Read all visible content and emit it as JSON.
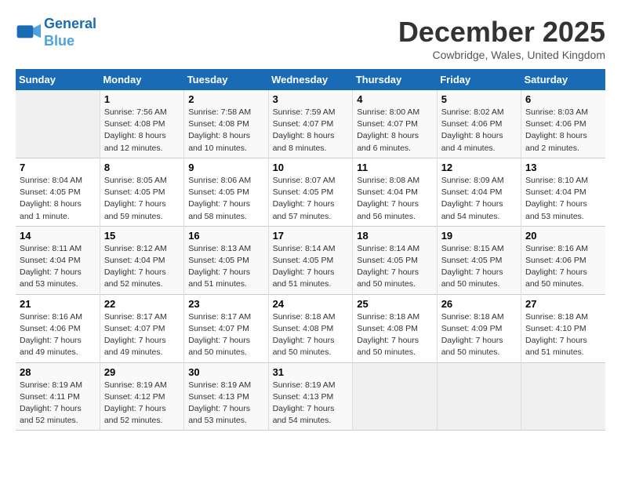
{
  "header": {
    "logo_line1": "General",
    "logo_line2": "Blue",
    "month_title": "December 2025",
    "location": "Cowbridge, Wales, United Kingdom"
  },
  "days_of_week": [
    "Sunday",
    "Monday",
    "Tuesday",
    "Wednesday",
    "Thursday",
    "Friday",
    "Saturday"
  ],
  "weeks": [
    [
      {
        "day": "",
        "info": ""
      },
      {
        "day": "1",
        "info": "Sunrise: 7:56 AM\nSunset: 4:08 PM\nDaylight: 8 hours\nand 12 minutes."
      },
      {
        "day": "2",
        "info": "Sunrise: 7:58 AM\nSunset: 4:08 PM\nDaylight: 8 hours\nand 10 minutes."
      },
      {
        "day": "3",
        "info": "Sunrise: 7:59 AM\nSunset: 4:07 PM\nDaylight: 8 hours\nand 8 minutes."
      },
      {
        "day": "4",
        "info": "Sunrise: 8:00 AM\nSunset: 4:07 PM\nDaylight: 8 hours\nand 6 minutes."
      },
      {
        "day": "5",
        "info": "Sunrise: 8:02 AM\nSunset: 4:06 PM\nDaylight: 8 hours\nand 4 minutes."
      },
      {
        "day": "6",
        "info": "Sunrise: 8:03 AM\nSunset: 4:06 PM\nDaylight: 8 hours\nand 2 minutes."
      }
    ],
    [
      {
        "day": "7",
        "info": "Sunrise: 8:04 AM\nSunset: 4:05 PM\nDaylight: 8 hours\nand 1 minute."
      },
      {
        "day": "8",
        "info": "Sunrise: 8:05 AM\nSunset: 4:05 PM\nDaylight: 7 hours\nand 59 minutes."
      },
      {
        "day": "9",
        "info": "Sunrise: 8:06 AM\nSunset: 4:05 PM\nDaylight: 7 hours\nand 58 minutes."
      },
      {
        "day": "10",
        "info": "Sunrise: 8:07 AM\nSunset: 4:05 PM\nDaylight: 7 hours\nand 57 minutes."
      },
      {
        "day": "11",
        "info": "Sunrise: 8:08 AM\nSunset: 4:04 PM\nDaylight: 7 hours\nand 56 minutes."
      },
      {
        "day": "12",
        "info": "Sunrise: 8:09 AM\nSunset: 4:04 PM\nDaylight: 7 hours\nand 54 minutes."
      },
      {
        "day": "13",
        "info": "Sunrise: 8:10 AM\nSunset: 4:04 PM\nDaylight: 7 hours\nand 53 minutes."
      }
    ],
    [
      {
        "day": "14",
        "info": "Sunrise: 8:11 AM\nSunset: 4:04 PM\nDaylight: 7 hours\nand 53 minutes."
      },
      {
        "day": "15",
        "info": "Sunrise: 8:12 AM\nSunset: 4:04 PM\nDaylight: 7 hours\nand 52 minutes."
      },
      {
        "day": "16",
        "info": "Sunrise: 8:13 AM\nSunset: 4:05 PM\nDaylight: 7 hours\nand 51 minutes."
      },
      {
        "day": "17",
        "info": "Sunrise: 8:14 AM\nSunset: 4:05 PM\nDaylight: 7 hours\nand 51 minutes."
      },
      {
        "day": "18",
        "info": "Sunrise: 8:14 AM\nSunset: 4:05 PM\nDaylight: 7 hours\nand 50 minutes."
      },
      {
        "day": "19",
        "info": "Sunrise: 8:15 AM\nSunset: 4:05 PM\nDaylight: 7 hours\nand 50 minutes."
      },
      {
        "day": "20",
        "info": "Sunrise: 8:16 AM\nSunset: 4:06 PM\nDaylight: 7 hours\nand 50 minutes."
      }
    ],
    [
      {
        "day": "21",
        "info": "Sunrise: 8:16 AM\nSunset: 4:06 PM\nDaylight: 7 hours\nand 49 minutes."
      },
      {
        "day": "22",
        "info": "Sunrise: 8:17 AM\nSunset: 4:07 PM\nDaylight: 7 hours\nand 49 minutes."
      },
      {
        "day": "23",
        "info": "Sunrise: 8:17 AM\nSunset: 4:07 PM\nDaylight: 7 hours\nand 50 minutes."
      },
      {
        "day": "24",
        "info": "Sunrise: 8:18 AM\nSunset: 4:08 PM\nDaylight: 7 hours\nand 50 minutes."
      },
      {
        "day": "25",
        "info": "Sunrise: 8:18 AM\nSunset: 4:08 PM\nDaylight: 7 hours\nand 50 minutes."
      },
      {
        "day": "26",
        "info": "Sunrise: 8:18 AM\nSunset: 4:09 PM\nDaylight: 7 hours\nand 50 minutes."
      },
      {
        "day": "27",
        "info": "Sunrise: 8:18 AM\nSunset: 4:10 PM\nDaylight: 7 hours\nand 51 minutes."
      }
    ],
    [
      {
        "day": "28",
        "info": "Sunrise: 8:19 AM\nSunset: 4:11 PM\nDaylight: 7 hours\nand 52 minutes."
      },
      {
        "day": "29",
        "info": "Sunrise: 8:19 AM\nSunset: 4:12 PM\nDaylight: 7 hours\nand 52 minutes."
      },
      {
        "day": "30",
        "info": "Sunrise: 8:19 AM\nSunset: 4:13 PM\nDaylight: 7 hours\nand 53 minutes."
      },
      {
        "day": "31",
        "info": "Sunrise: 8:19 AM\nSunset: 4:13 PM\nDaylight: 7 hours\nand 54 minutes."
      },
      {
        "day": "",
        "info": ""
      },
      {
        "day": "",
        "info": ""
      },
      {
        "day": "",
        "info": ""
      }
    ]
  ]
}
